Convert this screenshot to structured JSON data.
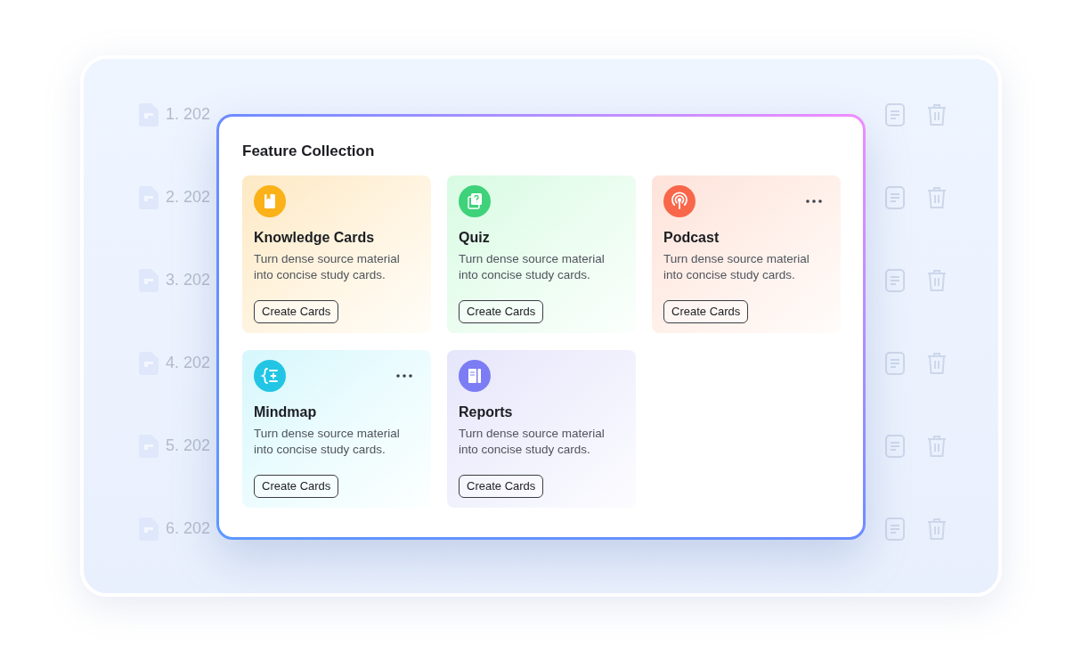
{
  "background_list": {
    "rows": [
      {
        "label": "1. 202"
      },
      {
        "label": "2. 202"
      },
      {
        "label": "3. 202"
      },
      {
        "label": "4. 202"
      },
      {
        "label": "5. 202"
      },
      {
        "label": "6. 202"
      }
    ]
  },
  "dialog": {
    "title": "Feature Collection",
    "cards": [
      {
        "kind": "book",
        "title": "Knowledge Cards",
        "description": "Turn dense source material into concise study cards.",
        "button": "Create Cards",
        "color": "#fbb118",
        "menu": false
      },
      {
        "kind": "quiz",
        "title": "Quiz",
        "description": "Turn dense source material into concise study cards.",
        "button": "Create Cards",
        "color": "#3ed27a",
        "menu": false
      },
      {
        "kind": "podcast",
        "title": "Podcast",
        "description": "Turn dense source material into concise study cards.",
        "button": "Create Cards",
        "color": "#f8674a",
        "menu": true
      },
      {
        "kind": "mindmap",
        "title": "Mindmap",
        "description": "Turn dense source material into concise study cards.",
        "button": "Create Cards",
        "color": "#22c6e4",
        "menu": true
      },
      {
        "kind": "report",
        "title": "Reports",
        "description": "Turn dense source material into concise study cards.",
        "button": "Create Cards",
        "color": "#7c7cf5",
        "menu": false
      }
    ]
  }
}
